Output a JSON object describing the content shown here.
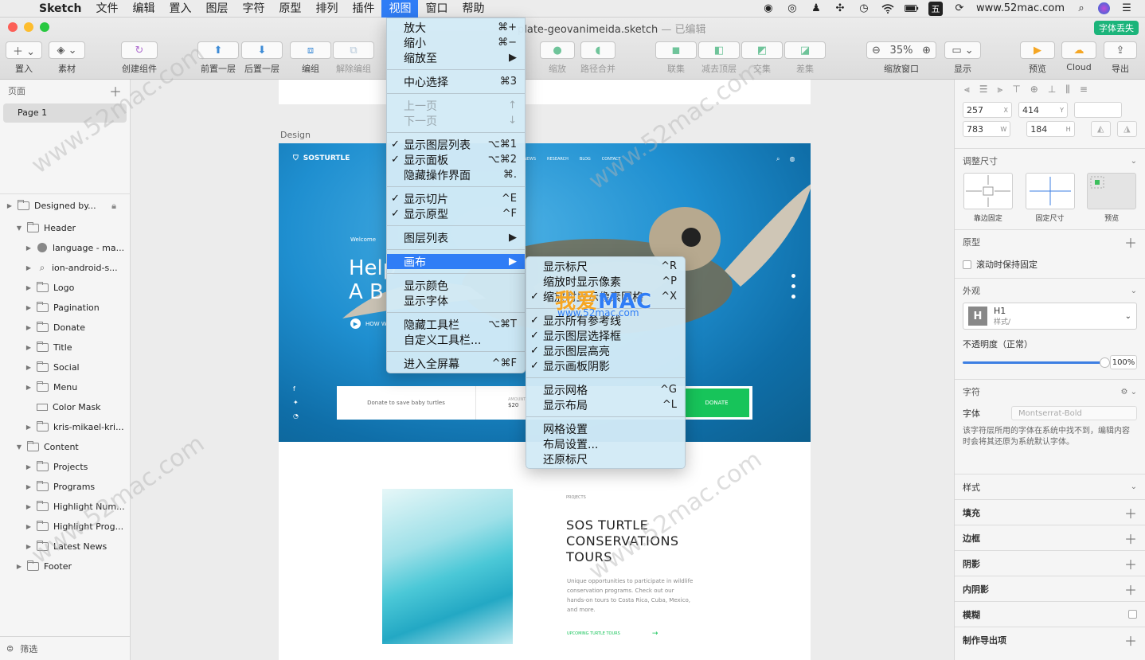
{
  "menubar": {
    "app": "Sketch",
    "items": [
      "文件",
      "编辑",
      "置入",
      "图层",
      "字符",
      "原型",
      "排列",
      "插件",
      "视图",
      "窗口",
      "帮助"
    ],
    "active_index": 8,
    "site": "www.52mac.com",
    "battery_icon": "battery-icon",
    "wifi_icon": "wifi-icon"
  },
  "window": {
    "doc_name": "plate-geovanimeida.sketch",
    "edited": "— 已编辑",
    "font_lost": "字体丢失"
  },
  "toolbar": {
    "insert": "置入",
    "assets": "素材",
    "create_symbol": "创建组件",
    "forward": "前置一层",
    "backward": "后置一层",
    "group": "编组",
    "ungroup": "解除编组",
    "scale": "缩放",
    "flatten": "路径合并",
    "union": "联集",
    "subtract": "减去顶层",
    "intersect": "交集",
    "difference": "差集",
    "zoom_value": "35%",
    "zoom": "缩放窗口",
    "display": "显示",
    "preview": "预览",
    "cloud": "Cloud",
    "export": "导出"
  },
  "sidebar": {
    "pages_label": "页面",
    "page": "Page 1",
    "layers": [
      {
        "name": "Designed by...",
        "icon": "folder-icon",
        "level": 0,
        "arrow": "▶",
        "locked": true,
        "kind": "group-top"
      },
      {
        "name": "Design",
        "icon": "artboard-icon",
        "level": 0,
        "arrow": "▼",
        "kind": "artboard"
      },
      {
        "name": "Header",
        "icon": "folder-icon",
        "level": 1,
        "arrow": "▼"
      },
      {
        "name": "language - ma...",
        "icon": "round-icon",
        "level": 2,
        "arrow": "▶"
      },
      {
        "name": "ion-android-s...",
        "icon": "search-icon",
        "level": 2,
        "arrow": "▶"
      },
      {
        "name": "Logo",
        "icon": "folder-icon",
        "level": 2,
        "arrow": "▶"
      },
      {
        "name": "Pagination",
        "icon": "folder-icon",
        "level": 2,
        "arrow": "▶"
      },
      {
        "name": "Donate",
        "icon": "folder-icon",
        "level": 2,
        "arrow": "▶"
      },
      {
        "name": "Title",
        "icon": "folder-icon",
        "level": 2,
        "arrow": "▶"
      },
      {
        "name": "Social",
        "icon": "folder-icon",
        "level": 2,
        "arrow": "▶"
      },
      {
        "name": "Menu",
        "icon": "folder-icon",
        "level": 2,
        "arrow": "▶"
      },
      {
        "name": "Color Mask",
        "icon": "rect-icon",
        "level": 2,
        "arrow": ""
      },
      {
        "name": "kris-mikael-kri...",
        "icon": "folder-icon",
        "level": 2,
        "arrow": "▶"
      },
      {
        "name": "Content",
        "icon": "folder-icon",
        "level": 1,
        "arrow": "▼"
      },
      {
        "name": "Projects",
        "icon": "folder-icon",
        "level": 2,
        "arrow": "▶"
      },
      {
        "name": "Programs",
        "icon": "folder-icon",
        "level": 2,
        "arrow": "▶"
      },
      {
        "name": "Highlight Num...",
        "icon": "folder-icon",
        "level": 2,
        "arrow": "▶"
      },
      {
        "name": "Highlight Prog...",
        "icon": "folder-icon",
        "level": 2,
        "arrow": "▶"
      },
      {
        "name": "Latest News",
        "icon": "folder-icon",
        "level": 2,
        "arrow": "▶"
      },
      {
        "name": "Footer",
        "icon": "folder-icon",
        "level": 1,
        "arrow": "▶"
      }
    ],
    "filter": "筛选"
  },
  "canvas": {
    "artboard_label": "Design",
    "logo": "SOSTURTLE",
    "nav": [
      "NEWS",
      "RESEARCH",
      "BLOG",
      "CONTACT"
    ],
    "welcome": "Welcome",
    "headline_line1": "Help",
    "headline_line2": "A B",
    "how": "HOW W",
    "donate_text": "Donate to save baby turtles",
    "amount_label": "AMOUNT",
    "amount": "$20",
    "donate_btn": "DONATE",
    "projects_label": "PROJECTS",
    "proj_title_1": "SOS TURTLE",
    "proj_title_2": "CONSERVATIONS",
    "proj_title_3": "TOURS",
    "proj_text": "Unique opportunities to participate in wildlife conservation programs. Check out our hands-on tours to Costa Rica, Cuba, Mexico, and more.",
    "proj_link": "UPCOMING TURTLE TOURS",
    "proj_arrow": "→"
  },
  "view_menu": [
    {
      "label": "放大",
      "sc": "⌘+"
    },
    {
      "label": "缩小",
      "sc": "⌘−"
    },
    {
      "label": "缩放至",
      "sc": "▶"
    },
    {
      "sep": true
    },
    {
      "label": "中心选择",
      "sc": "⌘3"
    },
    {
      "sep": true
    },
    {
      "label": "上一页",
      "sc": "↑",
      "disabled": true
    },
    {
      "label": "下一页",
      "sc": "↓",
      "disabled": true
    },
    {
      "sep": true
    },
    {
      "label": "显示图层列表",
      "sc": "⌥⌘1",
      "check": true
    },
    {
      "label": "显示面板",
      "sc": "⌥⌘2",
      "check": true
    },
    {
      "label": "隐藏操作界面",
      "sc": "⌘."
    },
    {
      "sep": true
    },
    {
      "label": "显示切片",
      "sc": "^E",
      "check": true
    },
    {
      "label": "显示原型",
      "sc": "^F",
      "check": true
    },
    {
      "sep": true
    },
    {
      "label": "图层列表",
      "sc": "▶"
    },
    {
      "sep": true
    },
    {
      "label": "画布",
      "sc": "▶",
      "highlight": true
    },
    {
      "sep": true
    },
    {
      "label": "显示颜色",
      "sc": ""
    },
    {
      "label": "显示字体",
      "sc": ""
    },
    {
      "sep": true
    },
    {
      "label": "隐藏工具栏",
      "sc": "⌥⌘T"
    },
    {
      "label": "自定义工具栏...",
      "sc": ""
    },
    {
      "sep": true
    },
    {
      "label": "进入全屏幕",
      "sc": "^⌘F"
    }
  ],
  "canvas_menu": [
    {
      "label": "显示标尺",
      "sc": "^R"
    },
    {
      "label": "缩放时显示像素",
      "sc": "^P"
    },
    {
      "label": "缩放时显示像素网格",
      "sc": "^X",
      "check": true
    },
    {
      "sep": true
    },
    {
      "label": "显示所有参考线",
      "sc": "",
      "check": true
    },
    {
      "label": "显示图层选择框",
      "sc": "",
      "check": true
    },
    {
      "label": "显示图层高亮",
      "sc": "",
      "check": true
    },
    {
      "label": "显示画板阴影",
      "sc": "",
      "check": true
    },
    {
      "sep": true
    },
    {
      "label": "显示网格",
      "sc": "^G"
    },
    {
      "label": "显示布局",
      "sc": "^L"
    },
    {
      "sep": true
    },
    {
      "label": "网格设置",
      "sc": ""
    },
    {
      "label": "布局设置...",
      "sc": ""
    },
    {
      "label": "还原标尺",
      "sc": ""
    }
  ],
  "watermark": {
    "brand_a": "我爱",
    "brand_b": "MAC",
    "url": "www.52mac.com",
    "diag": "www.52mac.com"
  },
  "inspector": {
    "x": "257",
    "y": "414",
    "w": "783",
    "w_label": "W",
    "h": "184",
    "h_label": "H",
    "resize_title": "调整尺寸",
    "resize_opts": [
      "靠边固定",
      "固定尺寸",
      "预览"
    ],
    "prototype": "原型",
    "fix_scroll": "滚动时保持固定",
    "appearance": "外观",
    "style_name": "H1",
    "style_sub": "样式/",
    "opacity_label": "不透明度（正常）",
    "opacity": "100%",
    "text_title": "字符",
    "font_label": "字体",
    "font_value": "Montserrat-Bold",
    "font_warning": "该字符层所用的字体在系统中找不到，编辑内容时会将其还原为系统默认字体。",
    "props": [
      "样式",
      "填充",
      "边框",
      "阴影",
      "内阴影",
      "模糊",
      "制作导出项"
    ]
  }
}
